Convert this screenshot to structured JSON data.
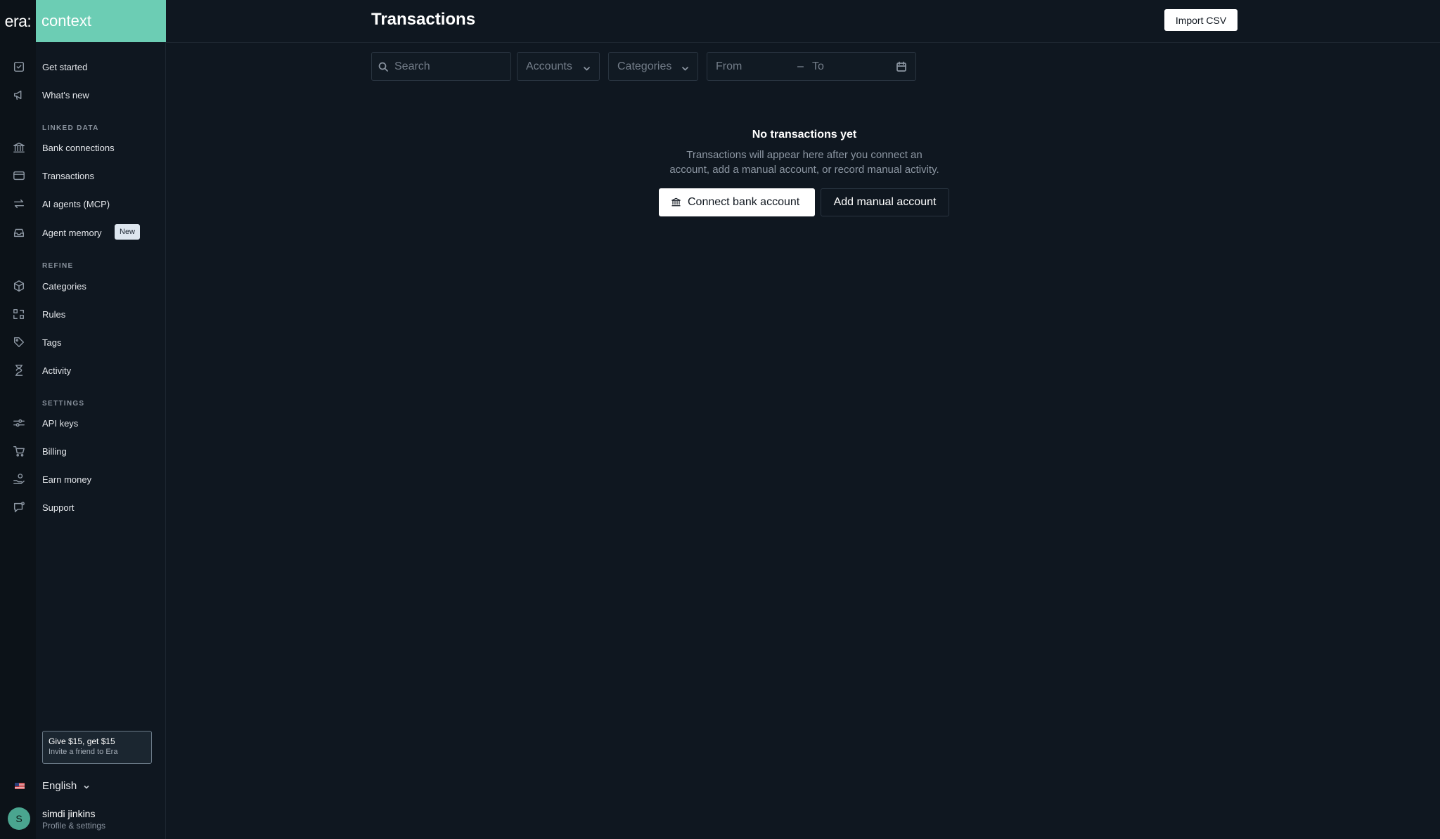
{
  "brand": {
    "era": "era:",
    "product": "context"
  },
  "sidebar": {
    "top_items": [
      {
        "label": "Get started",
        "icon": "checklist-icon"
      },
      {
        "label": "What's new",
        "icon": "megaphone-icon"
      }
    ],
    "sections": [
      {
        "heading": "LINKED DATA",
        "items": [
          {
            "label": "Bank connections",
            "icon": "bank-icon"
          },
          {
            "label": "Transactions",
            "icon": "credit-card-icon",
            "active": true
          },
          {
            "label": "AI agents (MCP)",
            "icon": "arrows-exchange-icon"
          },
          {
            "label": "Agent memory",
            "icon": "inbox-icon",
            "badge": "New"
          }
        ]
      },
      {
        "heading": "REFINE",
        "items": [
          {
            "label": "Categories",
            "icon": "cube-icon"
          },
          {
            "label": "Rules",
            "icon": "rules-icon"
          },
          {
            "label": "Tags",
            "icon": "tag-icon"
          },
          {
            "label": "Activity",
            "icon": "hourglass-icon"
          }
        ]
      },
      {
        "heading": "SETTINGS",
        "items": [
          {
            "label": "API keys",
            "icon": "key-sliders-icon"
          },
          {
            "label": "Billing",
            "icon": "cart-icon"
          },
          {
            "label": "Earn money",
            "icon": "hand-coins-icon"
          },
          {
            "label": "Support",
            "icon": "chat-question-icon"
          }
        ]
      }
    ],
    "promo": {
      "title": "Give $15, get $15",
      "subtitle": "Invite a friend to Era"
    },
    "language": "English",
    "user": {
      "initial": "S",
      "name": "simdi jinkins",
      "subtitle": "Profile & settings"
    }
  },
  "header": {
    "title": "Transactions",
    "import_label": "Import CSV"
  },
  "filters": {
    "search_placeholder": "Search",
    "accounts_label": "Accounts",
    "categories_label": "Categories",
    "date_from": "From",
    "date_separator": "–",
    "date_to": "To"
  },
  "empty_state": {
    "title": "No transactions yet",
    "description_line1": "Transactions will appear here after you connect an",
    "description_line2": "account, add a manual account, or record manual activity.",
    "connect_label": "Connect bank account",
    "manual_label": "Add manual account"
  },
  "colors": {
    "accent": "#6ccdb4",
    "background": "#0f1720",
    "sidebar_rail": "#0c1218"
  }
}
